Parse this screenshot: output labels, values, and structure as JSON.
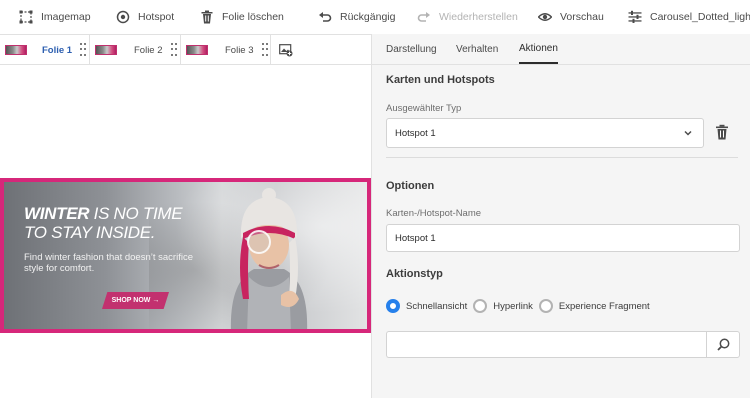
{
  "toolbar": {
    "imagemap": "Imagemap",
    "hotspot": "Hotspot",
    "delete_slide": "Folie löschen",
    "undo": "Rückgängig",
    "redo": "Wiederherstellen",
    "preview": "Vorschau",
    "viewer_preset": "Carousel_Dotted_light"
  },
  "slides": [
    {
      "label": "Folie 1",
      "active": true
    },
    {
      "label": "Folie 2",
      "active": false
    },
    {
      "label": "Folie 3",
      "active": false
    }
  ],
  "banner": {
    "headline_bold": "WINTER",
    "headline_rest": " IS NO TIME",
    "headline_line2": "TO STAY INSIDE.",
    "subline": "Find winter fashion that doesn’t sacrifice style for comfort.",
    "cta": "SHOP NOW →"
  },
  "panel": {
    "tabs": [
      "Darstellung",
      "Verhalten",
      "Aktionen"
    ],
    "active_tab": "Aktionen",
    "section_cards": "Karten und Hotspots",
    "selected_type_label": "Ausgewählter Typ",
    "selected_type_value": "Hotspot 1",
    "section_options": "Optionen",
    "name_label": "Karten-/Hotspot-Name",
    "name_value": "Hotspot 1",
    "action_type_title": "Aktionstyp",
    "action_options": [
      "Schnellansicht",
      "Hyperlink",
      "Experience Fragment"
    ],
    "action_selected": "Schnellansicht",
    "search_value": ""
  },
  "colors": {
    "accent_blue": "#2680eb",
    "active_tab_text": "#2d5fb0",
    "banner_border": "#d6277a"
  }
}
